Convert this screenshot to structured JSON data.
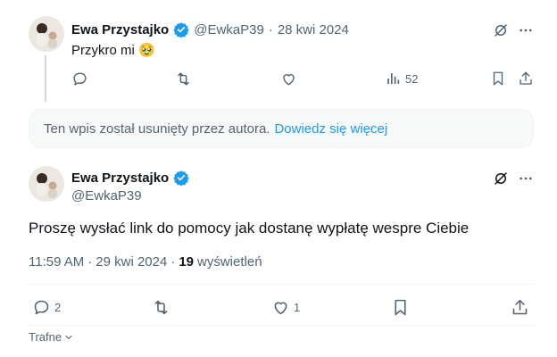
{
  "reply_tweet": {
    "author_name": "Ewa Przystajko",
    "handle": "@EwkaP39",
    "separator": "·",
    "date": "28 kwi 2024",
    "text": "Przykro mi 🥹",
    "actions": {
      "views": "52"
    }
  },
  "deleted_notice": {
    "text": "Ten wpis został usunięty przez autora.",
    "link": "Dowiedz się więcej"
  },
  "main_tweet": {
    "author_name": "Ewa Przystajko",
    "handle": "@EwkaP39",
    "text": "Proszę wysłać link do pomocy jak dostanę wypłatę wespre Ciebie",
    "time": "11:59 AM",
    "separator": "·",
    "date": "29 kwi 2024",
    "separator2": "·",
    "views_count": "19",
    "views_label": "wyświetleń",
    "actions": {
      "replies": "2",
      "likes": "1"
    }
  },
  "sort": {
    "label": "Trafne"
  },
  "colors": {
    "accent": "#1d9bf0",
    "muted": "#536471",
    "text": "#0f1419"
  }
}
